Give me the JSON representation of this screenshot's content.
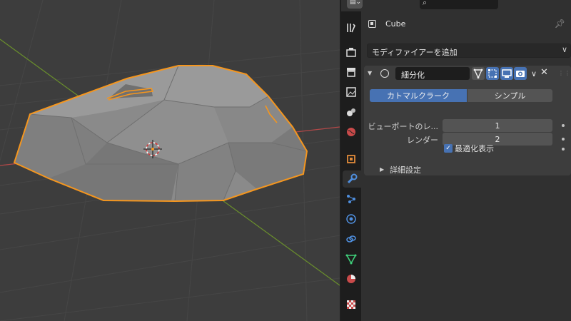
{
  "app": "Blender",
  "header": {
    "editor_type_icon": "properties-editor-icon",
    "search_icon": "⌕"
  },
  "object": {
    "name": "Cube",
    "icon": "object-icon"
  },
  "add_modifier": {
    "label": "モディファイアーを追加",
    "chevron": "∨"
  },
  "modifier": {
    "name": "細分化",
    "close": "✕",
    "mode_catmull": "カトマルクラーク",
    "mode_simple": "シンプル",
    "selected_mode": "カトマルクラーク",
    "viewport_label": "ビューポートのレ...",
    "viewport_levels": "1",
    "render_label": "レンダー",
    "render_levels": "2",
    "optimal_display_label": "最適化表示",
    "optimal_display_checked": true,
    "advanced_label": "詳細設定"
  },
  "tabs": [
    {
      "name": "tool",
      "active": false
    },
    {
      "name": "render",
      "active": false
    },
    {
      "name": "output",
      "active": false
    },
    {
      "name": "view-layer",
      "active": false
    },
    {
      "name": "scene",
      "active": false
    },
    {
      "name": "world",
      "active": false
    },
    {
      "name": "object",
      "active": false
    },
    {
      "name": "modifiers",
      "active": true
    },
    {
      "name": "particles",
      "active": false
    },
    {
      "name": "physics",
      "active": false
    },
    {
      "name": "constraints",
      "active": false
    },
    {
      "name": "data",
      "active": false
    },
    {
      "name": "material",
      "active": false
    },
    {
      "name": "texture",
      "active": false
    }
  ],
  "colors": {
    "accent": "#4772b3",
    "selection_outline": "#f5961e",
    "axis_x": "#b34848",
    "axis_y": "#6a8f2c"
  }
}
